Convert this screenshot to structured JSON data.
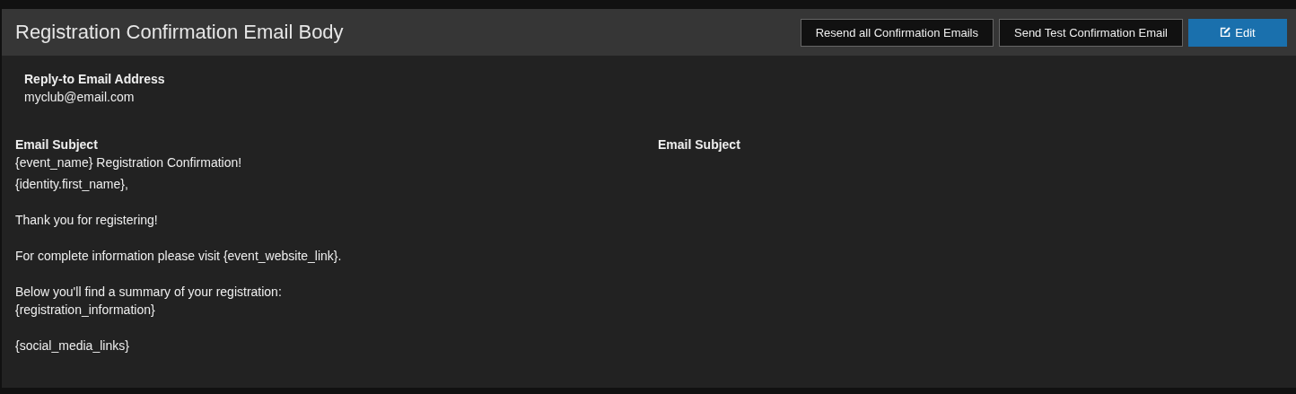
{
  "panel": {
    "title": "Registration Confirmation Email Body",
    "buttons": [
      {
        "label": "Resend all Confirmation Emails",
        "kind": "dark"
      },
      {
        "label": "Send Test Confirmation Email",
        "kind": "dark"
      },
      {
        "label": "Edit",
        "kind": "primary"
      }
    ]
  },
  "reply_to": {
    "label": "Reply-to Email Address",
    "value": "myclub@email.com"
  },
  "columns": [
    {
      "label": "Email Subject",
      "subject": "{event_name} Registration Confirmation!",
      "paragraphs": [
        [
          "{identity.first_name},"
        ],
        [
          "Thank you for registering!"
        ],
        [
          "For complete information please visit {event_website_link}."
        ],
        [
          "Below you'll find a summary of your registration:",
          "{registration_information}"
        ],
        [
          "{social_media_links}"
        ]
      ]
    },
    {
      "label": "Email Subject"
    }
  ]
}
